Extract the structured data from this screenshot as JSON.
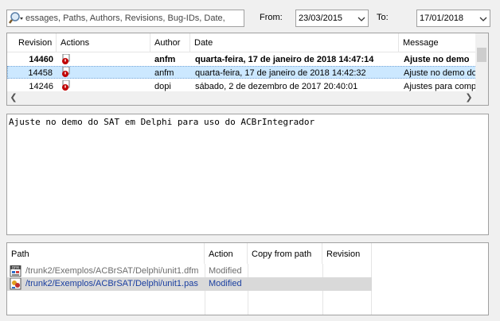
{
  "search": {
    "placeholder": "essages, Paths, Authors, Revisions, Bug-IDs, Date,",
    "icon": "search-icon"
  },
  "date_range": {
    "from_label": "From:",
    "from_value": "23/03/2015",
    "to_label": "To:",
    "to_value": "17/01/2018"
  },
  "log_table": {
    "columns": [
      "Revision",
      "Actions",
      "Author",
      "Date",
      "Message"
    ],
    "rows": [
      {
        "revision": "14460",
        "author": "anfm",
        "date": "quarta-feira, 17 de janeiro de 2018 14:47:14",
        "message": "Ajuste no demo",
        "bold": true,
        "selected": false
      },
      {
        "revision": "14458",
        "author": "anfm",
        "date": "quarta-feira, 17 de janeiro de 2018 14:42:32",
        "message": "Ajuste no demo do",
        "bold": false,
        "selected": true
      },
      {
        "revision": "14246",
        "author": "dopi",
        "date": "sábado, 2 de dezembro de 2017 20:40:01",
        "message": "Ajustes para compi",
        "bold": false,
        "selected": false
      }
    ]
  },
  "message_text": "Ajuste no demo do SAT em Delphi para uso do ACBrIntegrador",
  "paths_table": {
    "columns": [
      "Path",
      "Action",
      "Copy from path",
      "Revision"
    ],
    "rows": [
      {
        "path": "/trunk2/Exemplos/ACBrSAT/Delphi/unit1.dfm",
        "action": "Modified",
        "copy_from": "",
        "revision": "",
        "icon": "dfm-file-icon",
        "selected": false
      },
      {
        "path": "/trunk2/Exemplos/ACBrSAT/Delphi/unit1.pas",
        "action": "Modified",
        "copy_from": "",
        "revision": "",
        "icon": "pas-file-icon",
        "selected": true
      }
    ]
  },
  "colors": {
    "selected_row": "#cce8ff",
    "modified_red": "#c00000",
    "path_blue": "#1a3fa0"
  }
}
